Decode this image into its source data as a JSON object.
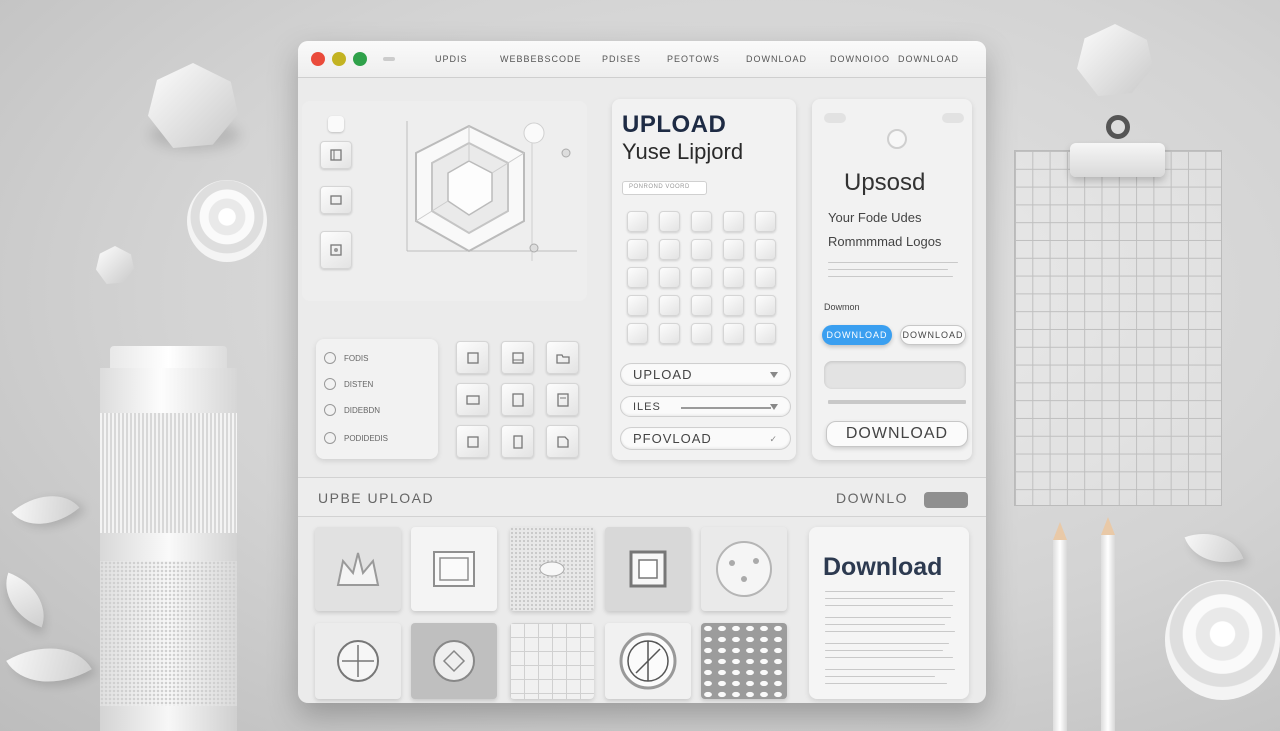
{
  "window": {
    "title_bar": {
      "traffic_lights": [
        {
          "name": "close",
          "color": "#ea4b3b"
        },
        {
          "name": "minimize",
          "color": "#c3b322"
        },
        {
          "name": "maximize",
          "color": "#2fa14a"
        }
      ],
      "menu": [
        "UPDIS",
        "WEBBEBSCODE",
        "PDISES",
        "PEOTOWS",
        "DOWNLOAD",
        "DOWNOIOO",
        "DOWNLOAD"
      ]
    },
    "upload_card": {
      "heading": "UPLOAD",
      "subheading": "Yuse Lipjord",
      "field_placeholder": "PONROND VOORD",
      "select_upload": "UPLOAD",
      "select_files": "ILES",
      "select_pfovload": "PFOVLOAD"
    },
    "side_list": [
      "FODIS",
      "DISTEN",
      "DIDEBDN",
      "PODIDEDIS"
    ],
    "download_card": {
      "heading": "Upsosd",
      "line1": "Your Fode Udes",
      "line2": "Rommmmad Logos",
      "label": "Dowmon",
      "primary_button": "DOWNLOAD",
      "secondary_button": "DOWNLOAD",
      "big_button": "DOWNLOAD"
    },
    "lower_bar": {
      "left_label": "UPBE UPLOAD",
      "right_label": "DOWNLO"
    },
    "download_doc": {
      "title": "Download"
    }
  },
  "colors": {
    "accent_blue": "#3a9ff0",
    "window_bg": "#ebebeb",
    "panel_bg": "#f2f2f2"
  },
  "icons": [
    "sidebar-icon",
    "hexagon-cube-icon",
    "image-icon",
    "folder-icon",
    "grid-icon",
    "chevron-down-icon",
    "circle-icon"
  ]
}
